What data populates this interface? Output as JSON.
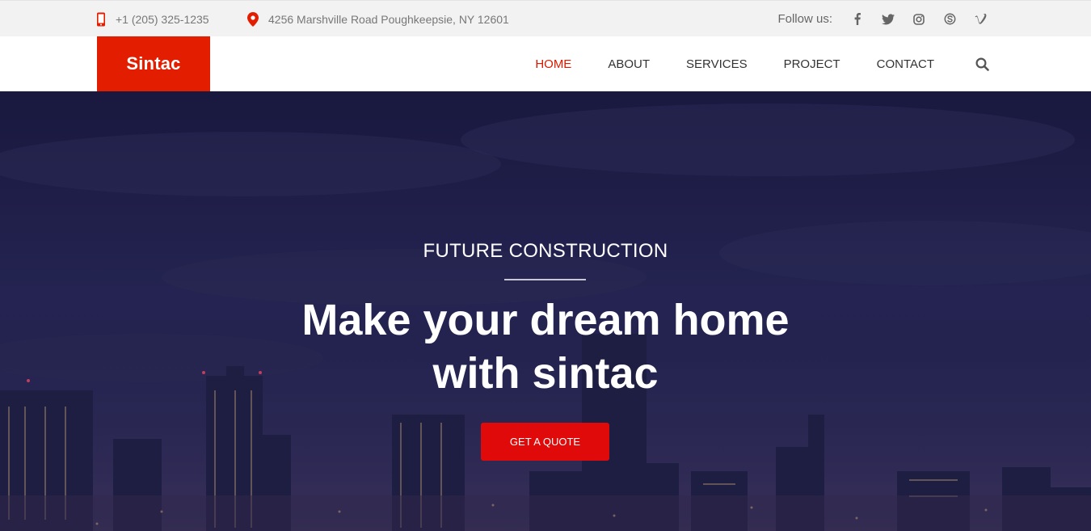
{
  "topbar": {
    "phone": "+1 (205) 325-1235",
    "address": "4256 Marshville Road Poughkeepsie, NY 12601",
    "follow_label": "Follow us:",
    "socials": [
      "facebook-icon",
      "twitter-icon",
      "instagram-icon",
      "skype-icon",
      "vimeo-icon"
    ]
  },
  "nav": {
    "logo": "Sintac",
    "items": [
      {
        "label": "HOME",
        "active": true
      },
      {
        "label": "ABOUT",
        "active": false
      },
      {
        "label": "SERVICES",
        "active": false
      },
      {
        "label": "PROJECT",
        "active": false
      },
      {
        "label": "CONTACT",
        "active": false
      }
    ]
  },
  "hero": {
    "subtitle": "FUTURE CONSTRUCTION",
    "title_line1": "Make your dream home",
    "title_line2": "with sintac",
    "cta_label": "GET A QUOTE"
  },
  "colors": {
    "accent": "#e31d00",
    "active_nav": "#d91a00",
    "topbar_bg": "#f2f2f2",
    "hero_tint": "#24234f"
  }
}
